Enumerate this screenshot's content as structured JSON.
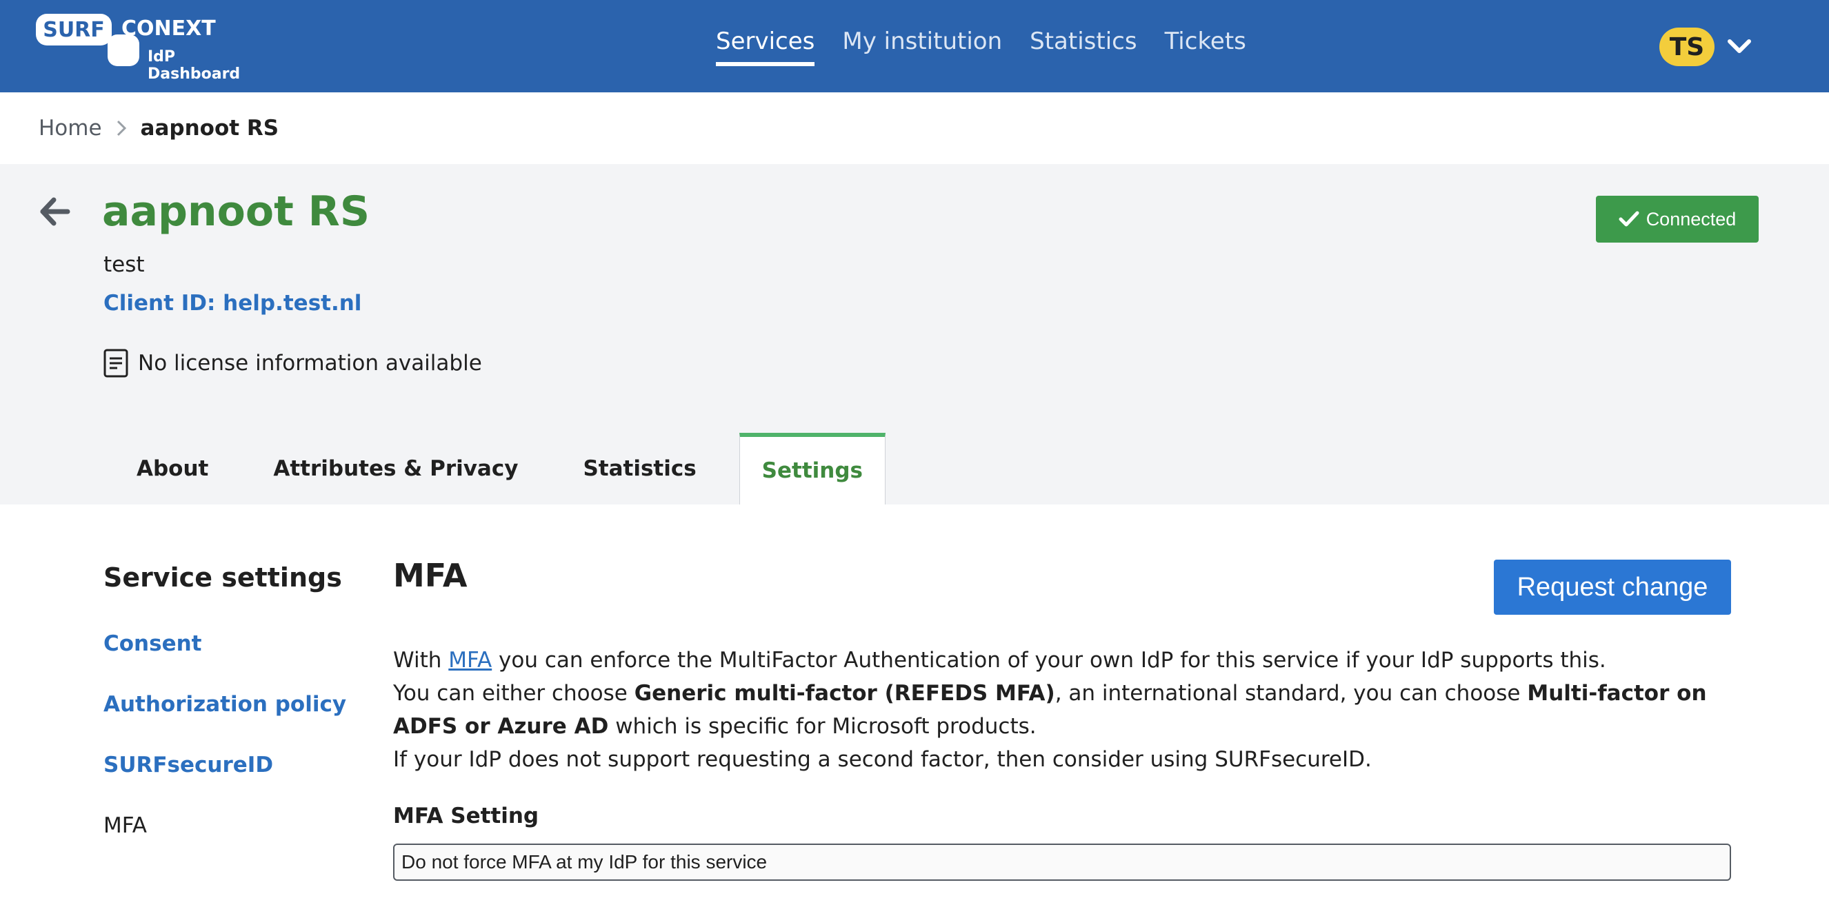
{
  "header": {
    "logo_badge": "SURF",
    "logo_main": "CONEXT",
    "logo_sub": "IdP Dashboard",
    "nav": [
      {
        "label": "Services",
        "active": true
      },
      {
        "label": "My institution",
        "active": false
      },
      {
        "label": "Statistics",
        "active": false
      },
      {
        "label": "Tickets",
        "active": false
      }
    ],
    "user_initials": "TS",
    "user_menu_icon": "chevron-down-icon"
  },
  "breadcrumb": {
    "home": "Home",
    "separator_icon": "chevron-right-icon",
    "current": "aapnoot RS"
  },
  "service": {
    "title": "aapnoot RS",
    "description": "test",
    "client_id": "Client ID: help.test.nl",
    "license_icon": "document-icon",
    "license_text": "No license information available",
    "status_icon": "check-icon",
    "status_label": "Connected",
    "back_icon": "arrow-left-icon"
  },
  "tabs": [
    {
      "label": "About",
      "active": false
    },
    {
      "label": "Attributes & Privacy",
      "active": false
    },
    {
      "label": "Statistics",
      "active": false
    },
    {
      "label": "Settings",
      "active": true
    }
  ],
  "sidebar": {
    "title": "Service settings",
    "items": [
      {
        "label": "Consent",
        "active": false
      },
      {
        "label": "Authorization policy",
        "active": false
      },
      {
        "label": "SURFsecureID",
        "active": false
      },
      {
        "label": "MFA",
        "active": true
      }
    ]
  },
  "mfa": {
    "title": "MFA",
    "request_button": "Request change",
    "p1_before": "With ",
    "p1_link": "MFA",
    "p1_after": " you can enforce the MultiFactor Authentication of your own IdP for this service if your IdP supports this.",
    "p2_a": "You can either choose ",
    "p2_b": "Generic multi-factor (REFEDS MFA)",
    "p2_c": ", an international standard, you can choose ",
    "p2_d": "Multi-factor on ADFS or Azure AD",
    "p2_e": " which is specific for Microsoft products.",
    "p3": "If your IdP does not support requesting a second factor, then consider using SURFsecureID.",
    "setting_label": "MFA Setting",
    "setting_value": "Do not force MFA at my IdP for this service"
  },
  "colors": {
    "header_bg": "#2b63ad",
    "title_green": "#3f8a3e",
    "link_blue": "#2b6fbf",
    "connected_green": "#3d9a4b",
    "button_blue": "#2b77d4",
    "avatar_yellow": "#f3cd3c"
  }
}
